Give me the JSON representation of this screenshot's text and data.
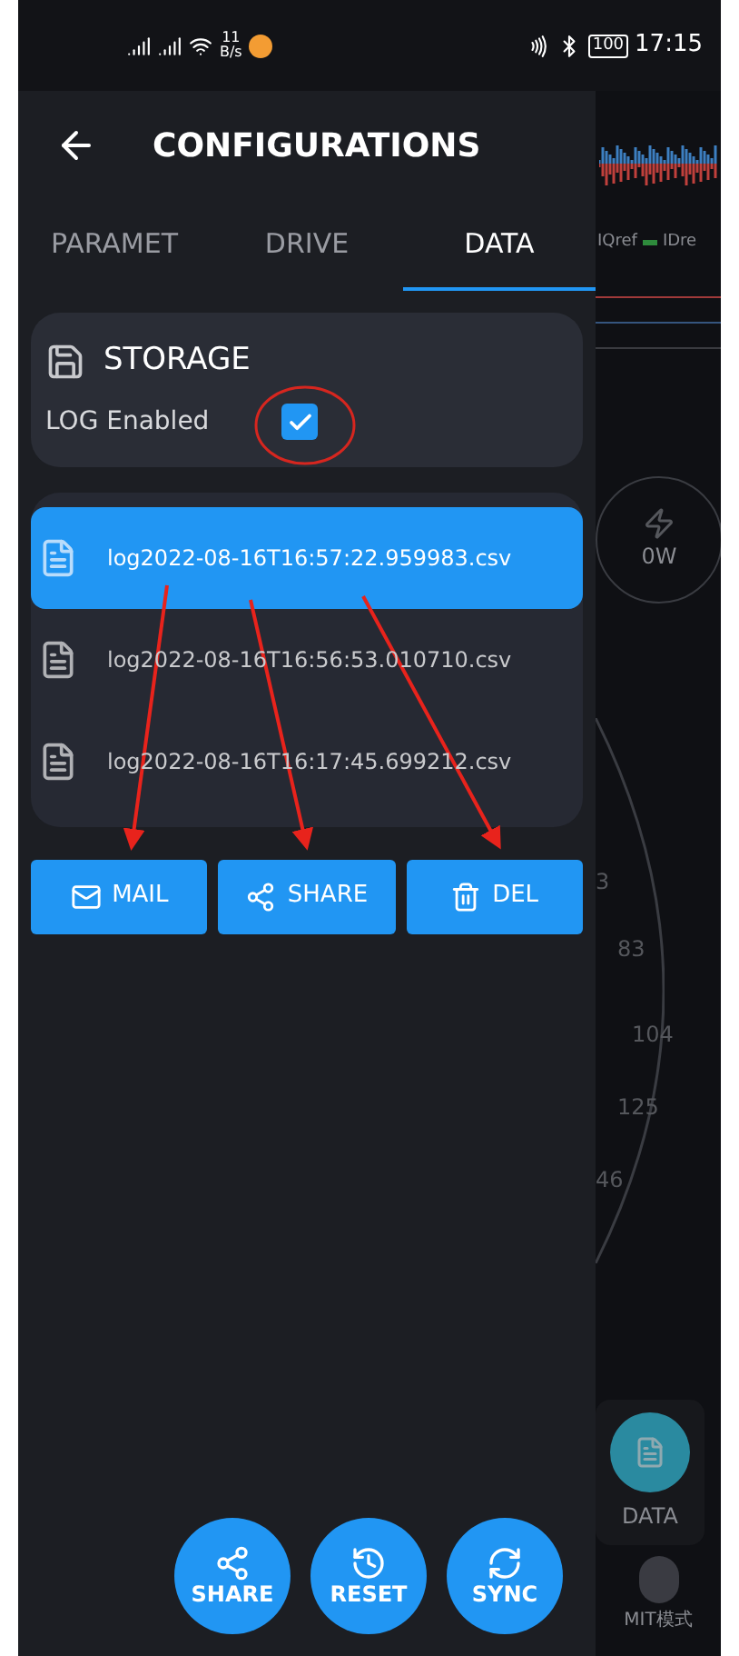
{
  "status_bar": {
    "network_speed": "11",
    "speed_unit": "B/s",
    "battery": "100",
    "time": "17:15"
  },
  "header": {
    "title": "CONFIGURATIONS"
  },
  "tabs": [
    {
      "label": "PARAMET",
      "selected": false
    },
    {
      "label": "DRIVE",
      "selected": false
    },
    {
      "label": "DATA",
      "selected": true
    }
  ],
  "storage": {
    "title": "STORAGE",
    "log_label": "LOG Enabled",
    "log_checked": true
  },
  "files": [
    {
      "name": "log2022-08-16T16:57:22.959983.csv",
      "selected": true
    },
    {
      "name": "log2022-08-16T16:56:53.010710.csv",
      "selected": false
    },
    {
      "name": "log2022-08-16T16:17:45.699212.csv",
      "selected": false
    }
  ],
  "file_actions": [
    {
      "label": "MAIL",
      "kind": "mail"
    },
    {
      "label": "SHARE",
      "kind": "share"
    },
    {
      "label": "DEL",
      "kind": "delete"
    }
  ],
  "fab": [
    {
      "label": "SHARE",
      "kind": "share"
    },
    {
      "label": "RESET",
      "kind": "reset"
    },
    {
      "label": "SYNC",
      "kind": "sync"
    }
  ],
  "background": {
    "legend": [
      "IQref",
      "IDre"
    ],
    "power": "0W",
    "gauge_labels": [
      "3",
      "83",
      "104",
      "125",
      "46"
    ],
    "nav": [
      {
        "label": "DATA"
      },
      {
        "label": "MIT模式"
      }
    ]
  }
}
